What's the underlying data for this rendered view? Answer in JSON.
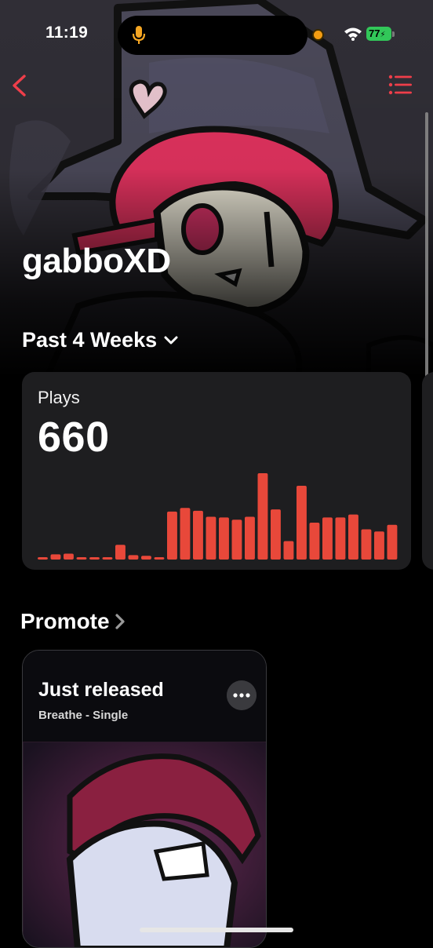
{
  "status_bar": {
    "time": "11:19",
    "battery": "77"
  },
  "header": {
    "back_icon": "chevron-left-icon",
    "menu_icon": "list-icon",
    "accent": "#ef3e4a"
  },
  "artist": {
    "name": "gabboXD"
  },
  "period_selector": {
    "label": "Past 4 Weeks",
    "icon": "chevron-down-icon"
  },
  "plays_card": {
    "label": "Plays",
    "value": "660",
    "bar_color": "#e8483a"
  },
  "chart_data": {
    "type": "bar",
    "series": [
      {
        "values": [
          3,
          7,
          8,
          3,
          0,
          3,
          20,
          6,
          5,
          1,
          65,
          70,
          66,
          58,
          57,
          54,
          58,
          117,
          68,
          25,
          100,
          50,
          57,
          57,
          61,
          41,
          38,
          47
        ]
      }
    ]
  },
  "promote": {
    "title": "Promote",
    "card": {
      "title": "Just released",
      "subtitle": "Breathe - Single",
      "more_icon": "ellipsis-icon"
    }
  }
}
